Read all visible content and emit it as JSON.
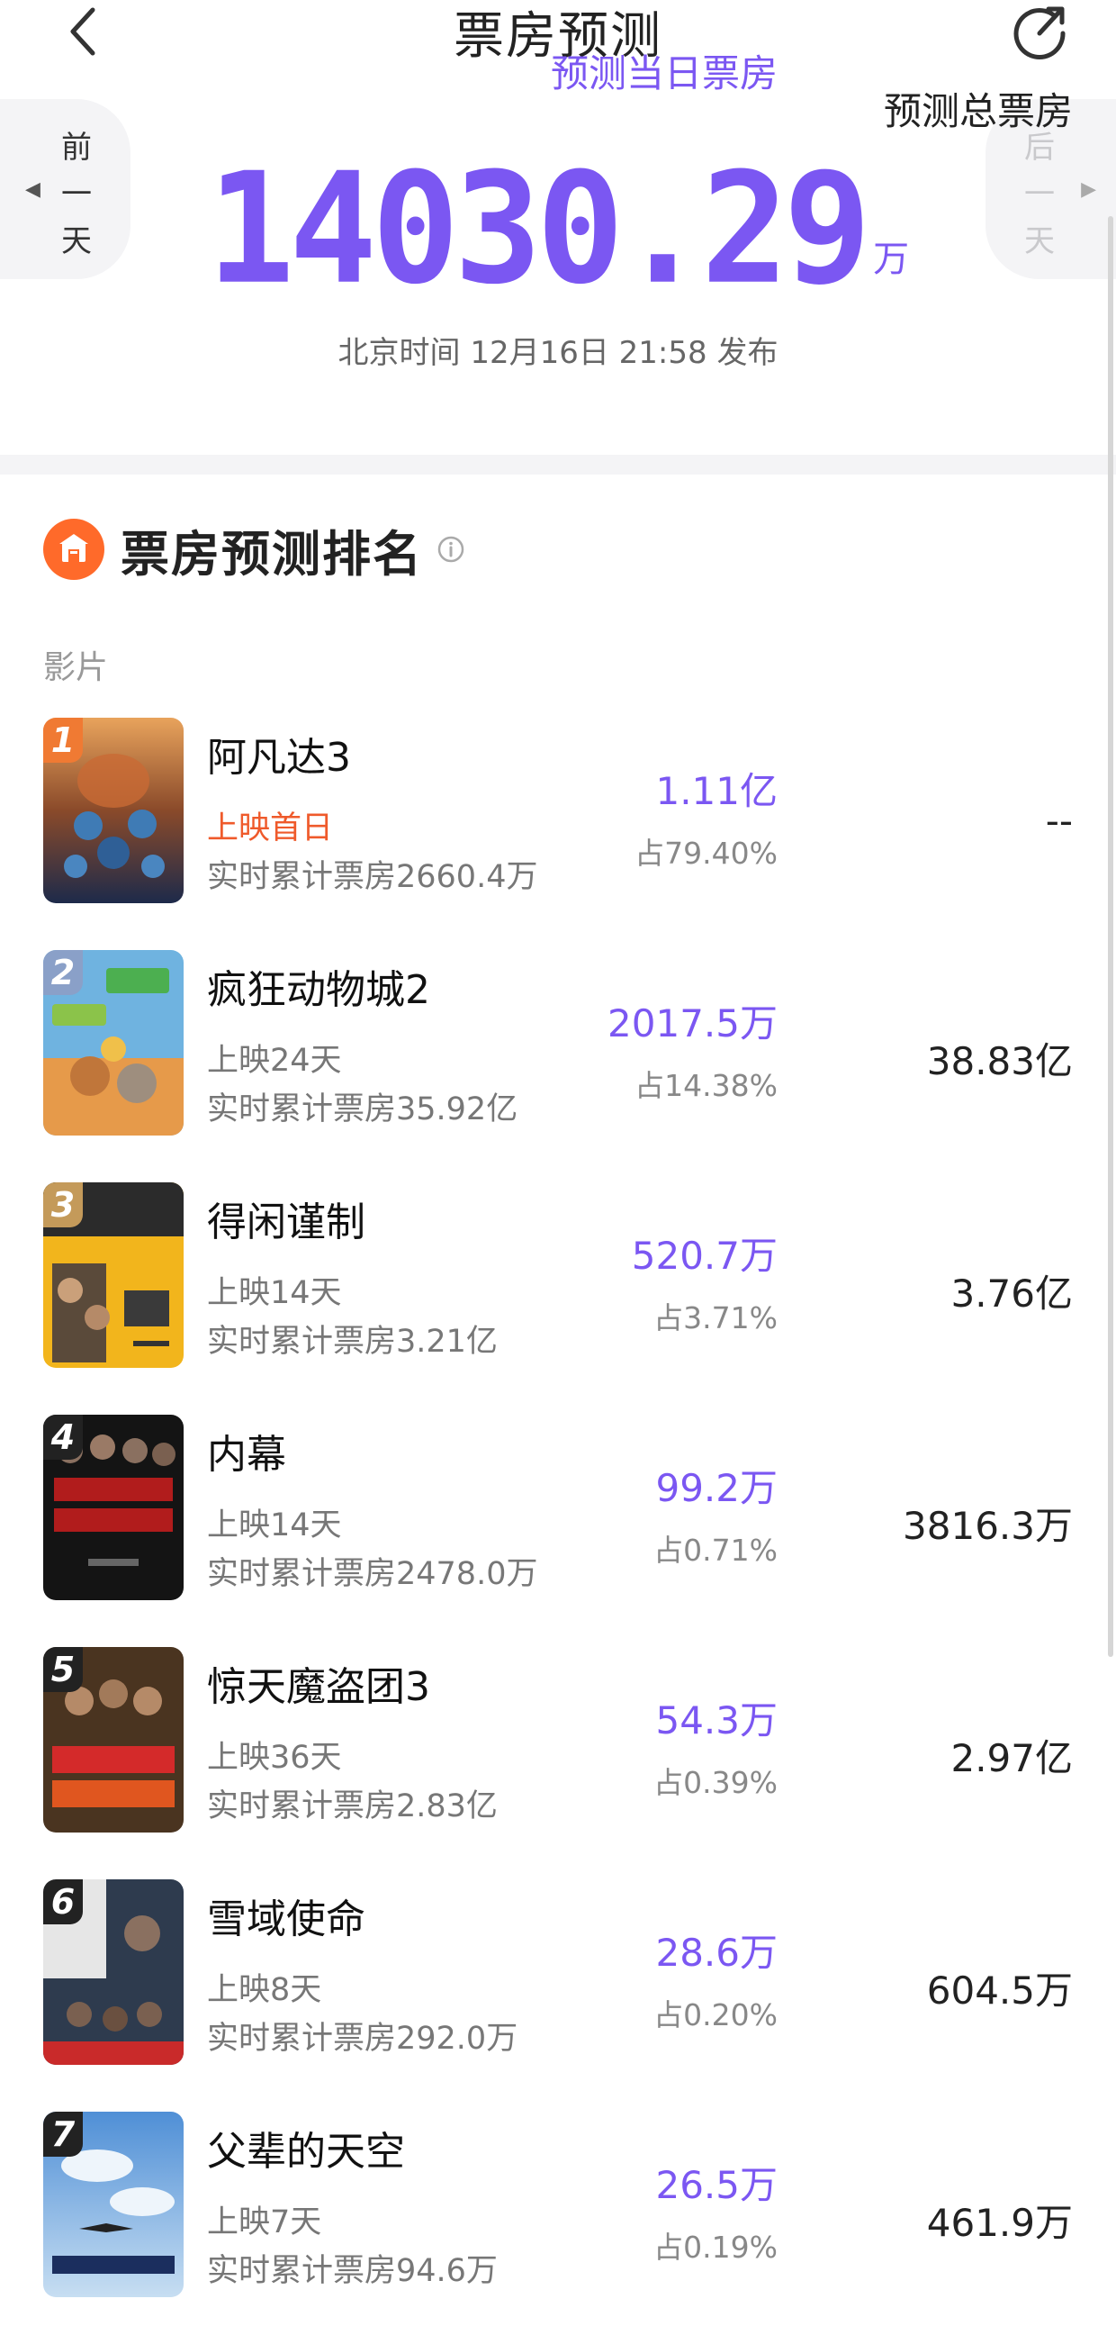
{
  "header": {
    "title": "票房预测"
  },
  "summary": {
    "prev_day": "前一天",
    "next_day": "后一天",
    "total_value": "14030.29",
    "total_unit": "万",
    "publish_time": "北京时间 12月16日 21:58 发布"
  },
  "section": {
    "title": "票房预测排名"
  },
  "columns": {
    "film": "影片",
    "daily": "预测当日票房",
    "total": "预测总票房"
  },
  "colors": {
    "accent": "#7b57f2",
    "first_day": "#ef5a2b",
    "section_icon": "#ff6a2a"
  },
  "movies": [
    {
      "rank": "1",
      "title": "阿凡达3",
      "days": "上映首日",
      "cumulative": "实时累计票房2660.4万",
      "daily": "1.11亿",
      "share": "占79.40%",
      "total": "--"
    },
    {
      "rank": "2",
      "title": "疯狂动物城2",
      "days": "上映24天",
      "cumulative": "实时累计票房35.92亿",
      "daily": "2017.5万",
      "share": "占14.38%",
      "total": "38.83亿"
    },
    {
      "rank": "3",
      "title": "得闲谨制",
      "days": "上映14天",
      "cumulative": "实时累计票房3.21亿",
      "daily": "520.7万",
      "share": "占3.71%",
      "total": "3.76亿"
    },
    {
      "rank": "4",
      "title": "内幕",
      "days": "上映14天",
      "cumulative": "实时累计票房2478.0万",
      "daily": "99.2万",
      "share": "占0.71%",
      "total": "3816.3万"
    },
    {
      "rank": "5",
      "title": "惊天魔盗团3",
      "days": "上映36天",
      "cumulative": "实时累计票房2.83亿",
      "daily": "54.3万",
      "share": "占0.39%",
      "total": "2.97亿"
    },
    {
      "rank": "6",
      "title": "雪域使命",
      "days": "上映8天",
      "cumulative": "实时累计票房292.0万",
      "daily": "28.6万",
      "share": "占0.20%",
      "total": "604.5万"
    },
    {
      "rank": "7",
      "title": "父辈的天空",
      "days": "上映7天",
      "cumulative": "实时累计票房94.6万",
      "daily": "26.5万",
      "share": "占0.19%",
      "total": "461.9万"
    }
  ]
}
